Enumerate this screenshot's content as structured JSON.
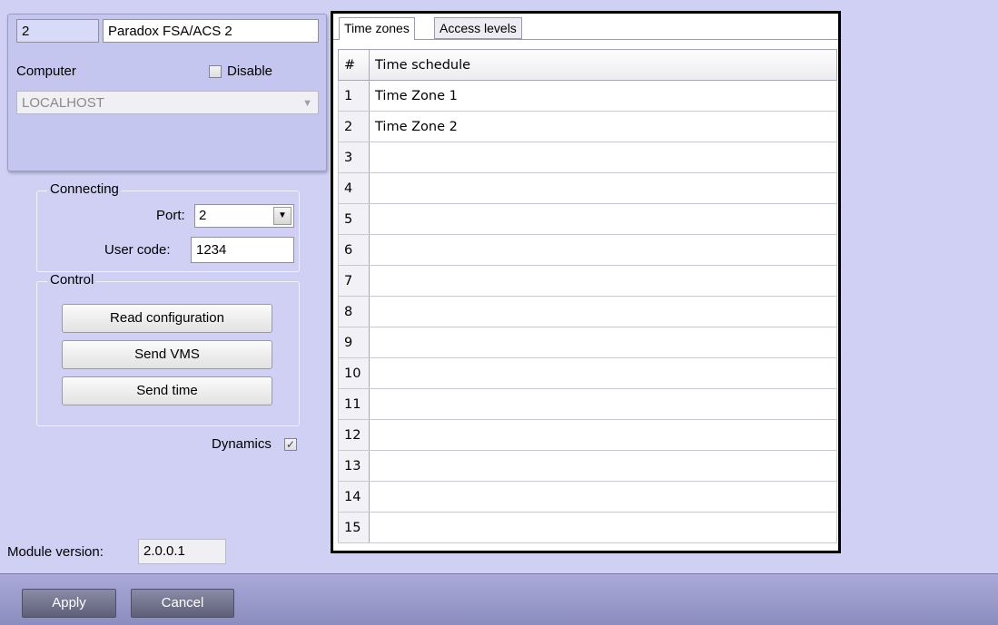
{
  "identity": {
    "id": "2",
    "name": "Paradox FSA/ACS 2",
    "computer_label": "Computer",
    "disable_label": "Disable",
    "disable_checked": false,
    "computer_value": "LOCALHOST"
  },
  "connecting": {
    "title": "Connecting",
    "port_label": "Port:",
    "port_value": "2",
    "user_code_label": "User code:",
    "user_code_value": "1234"
  },
  "control": {
    "title": "Control",
    "read_config_label": "Read configuration",
    "send_vms_label": "Send VMS",
    "send_time_label": "Send time"
  },
  "dynamics": {
    "label": "Dynamics",
    "checked": true
  },
  "module_version": {
    "label": "Module version:",
    "value": "2.0.0.1"
  },
  "tabs": [
    {
      "label": "Time zones",
      "active": true
    },
    {
      "label": "Access levels",
      "active": false
    }
  ],
  "grid": {
    "columns": [
      "#",
      "Time schedule"
    ],
    "rows": [
      {
        "num": "1",
        "name": "Time Zone 1"
      },
      {
        "num": "2",
        "name": "Time Zone 2"
      },
      {
        "num": "3",
        "name": ""
      },
      {
        "num": "4",
        "name": ""
      },
      {
        "num": "5",
        "name": ""
      },
      {
        "num": "6",
        "name": ""
      },
      {
        "num": "7",
        "name": ""
      },
      {
        "num": "8",
        "name": ""
      },
      {
        "num": "9",
        "name": ""
      },
      {
        "num": "10",
        "name": ""
      },
      {
        "num": "11",
        "name": ""
      },
      {
        "num": "12",
        "name": ""
      },
      {
        "num": "13",
        "name": ""
      },
      {
        "num": "14",
        "name": ""
      },
      {
        "num": "15",
        "name": ""
      }
    ]
  },
  "buttons": {
    "apply": "Apply",
    "cancel": "Cancel"
  },
  "icons": {
    "dropdown": "chevron-down-icon",
    "checkmark": "check-icon"
  },
  "colors": {
    "background": "#cfd0f4",
    "bottom_bar": "#9a9bcd"
  }
}
